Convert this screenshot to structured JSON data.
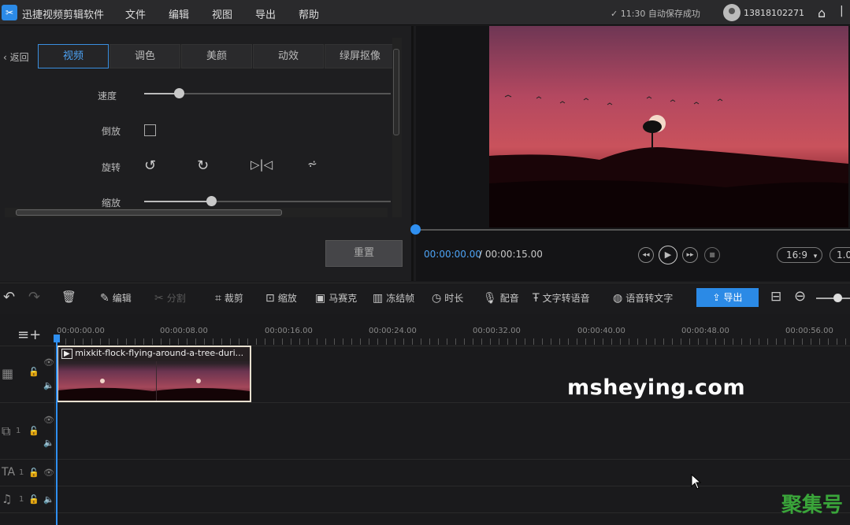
{
  "app": {
    "title": "迅捷视频剪辑软件",
    "logo_icon": "scissors-icon"
  },
  "menu": [
    "文件",
    "编辑",
    "视图",
    "导出",
    "帮助"
  ],
  "status": {
    "autosave": "✓ 11:30 自动保存成功",
    "user": "13818102271"
  },
  "props": {
    "back_label": "返回",
    "tabs": [
      "视频",
      "调色",
      "美颜",
      "动效",
      "绿屏抠像"
    ],
    "active_tab": "视频",
    "speed_label": "速度",
    "speed_value": 0.14,
    "reverse_label": "倒放",
    "reverse_checked": false,
    "rotate_label": "旋转",
    "rotate_icons": [
      "rotate-left-icon",
      "rotate-right-icon",
      "flip-horizontal-icon",
      "flip-vertical-icon"
    ],
    "scale_label": "缩放",
    "scale_value": 0.27,
    "reset_label": "重置"
  },
  "preview": {
    "time_current": "00:00:00.00",
    "time_total": "/ 00:00:15.00",
    "progress": 0,
    "ratio": "16:9",
    "zoom": "1.0"
  },
  "toolbar": {
    "edit": "编辑",
    "split": "分割",
    "crop": "裁剪",
    "scale": "缩放",
    "mosaic": "马赛克",
    "freeze": "冻结帧",
    "duration": "时长",
    "dub": "配音",
    "tts": "文字转语音",
    "stt": "语音转文字",
    "export": "导出"
  },
  "timeline": {
    "ruler": [
      "00:00:00.00",
      "00:00:08.00",
      "00:00:16.00",
      "00:00:24.00",
      "00:00:32.00",
      "00:00:40.00",
      "00:00:48.00",
      "00:00:56.00"
    ],
    "clip_name": "mixkit-flock-flying-around-a-tree-duri...",
    "track_numbers": {
      "overlay": "1",
      "text": "1",
      "music": "1"
    }
  },
  "watermark": "msheying.com",
  "corner_mark": "聚集号",
  "colors": {
    "accent": "#2b8ae6",
    "background": "#1b1b1d",
    "panel": "#1e1e20"
  }
}
